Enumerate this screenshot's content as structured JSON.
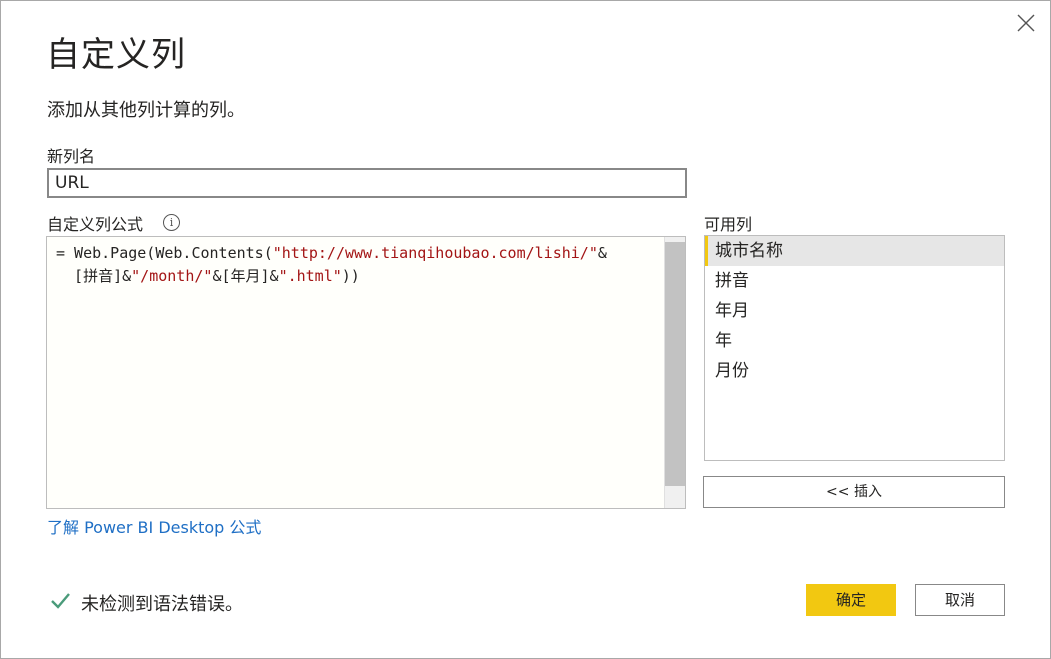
{
  "dialog": {
    "title": "自定义列",
    "subtitle": "添加从其他列计算的列。",
    "close_icon": "close-icon"
  },
  "new_column": {
    "label": "新列名",
    "value": "URL"
  },
  "formula": {
    "label": "自定义列公式",
    "info_icon": "info-icon",
    "line1_prefix": "= Web.Page(Web.Contents(",
    "line1_str": "\"http://www.tianqihoubao.com/lishi/\"",
    "line1_suffix": "&",
    "line2_a": "  [拼音]&",
    "line2_str1": "\"/month/\"",
    "line2_b": "&[年月]&",
    "line2_str2": "\".html\"",
    "line2_c": "))",
    "string_color": "#a31515"
  },
  "learn_link": "了解 Power BI Desktop 公式",
  "available_columns": {
    "label": "可用列",
    "items": [
      "城市名称",
      "拼音",
      "年月",
      "年",
      "月份"
    ],
    "selected_index": 0,
    "insert_label": "<< 插入"
  },
  "status": {
    "icon": "check-icon",
    "text": "未检测到语法错误。",
    "color": "#4a9b7a"
  },
  "buttons": {
    "ok": "确定",
    "cancel": "取消",
    "accent": "#f2c811"
  }
}
